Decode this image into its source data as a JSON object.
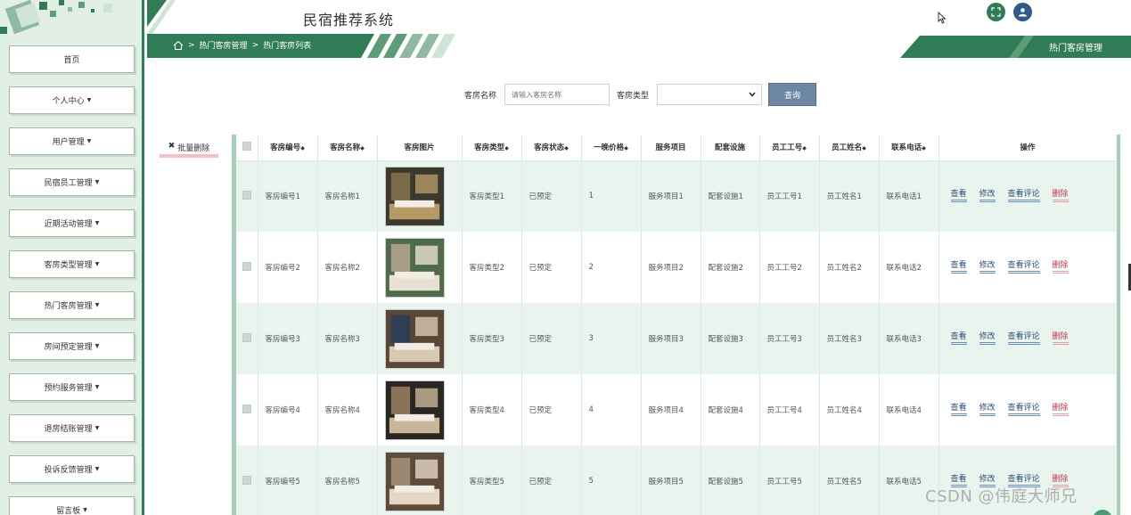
{
  "app": {
    "title": "民宿推荐系统"
  },
  "breadcrumb": {
    "items": [
      "热门客房管理",
      "热门客房列表"
    ]
  },
  "header": {
    "right_title": "热门客房管理"
  },
  "sidebar": {
    "items": [
      {
        "label": "首页",
        "dropdown": false
      },
      {
        "label": "个人中心",
        "dropdown": true
      },
      {
        "label": "用户管理",
        "dropdown": true
      },
      {
        "label": "民宿员工管理",
        "dropdown": true
      },
      {
        "label": "近期活动管理",
        "dropdown": true
      },
      {
        "label": "客房类型管理",
        "dropdown": true
      },
      {
        "label": "热门客房管理",
        "dropdown": true
      },
      {
        "label": "房间预定管理",
        "dropdown": true
      },
      {
        "label": "预约服务管理",
        "dropdown": true
      },
      {
        "label": "退房结账管理",
        "dropdown": true
      },
      {
        "label": "投诉反馈管理",
        "dropdown": true
      },
      {
        "label": "留言板",
        "dropdown": true
      }
    ]
  },
  "search": {
    "name_label": "客房名称",
    "name_placeholder": "请输入客房名称",
    "type_label": "客房类型",
    "type_value": "",
    "button": "查询"
  },
  "toolbar": {
    "batch_delete": "批量删除"
  },
  "table": {
    "columns": [
      "客房编号",
      "客房名称",
      "客房图片",
      "客房类型",
      "客房状态",
      "一晚价格",
      "服务项目",
      "配套设施",
      "员工工号",
      "员工姓名",
      "联系电话",
      "操作"
    ],
    "rows": [
      {
        "no": "客房编号1",
        "name": "客房名称1",
        "type": "客房类型1",
        "status": "已预定",
        "price": "1",
        "service": "服务项目1",
        "facility": "配套设施1",
        "staff_no": "员工工号1",
        "staff_name": "员工姓名1",
        "phone": "联系电话1"
      },
      {
        "no": "客房编号2",
        "name": "客房名称2",
        "type": "客房类型2",
        "status": "已预定",
        "price": "2",
        "service": "服务项目2",
        "facility": "配套设施2",
        "staff_no": "员工工号2",
        "staff_name": "员工姓名2",
        "phone": "联系电话2"
      },
      {
        "no": "客房编号3",
        "name": "客房名称3",
        "type": "客房类型3",
        "status": "已预定",
        "price": "3",
        "service": "服务项目3",
        "facility": "配套设施3",
        "staff_no": "员工工号3",
        "staff_name": "员工姓名3",
        "phone": "联系电话3"
      },
      {
        "no": "客房编号4",
        "name": "客房名称4",
        "type": "客房类型4",
        "status": "已预定",
        "price": "4",
        "service": "服务项目4",
        "facility": "配套设施4",
        "staff_no": "员工工号4",
        "staff_name": "员工姓名4",
        "phone": "联系电话4"
      },
      {
        "no": "客房编号5",
        "name": "客房名称5",
        "type": "客房类型5",
        "status": "已预定",
        "price": "5",
        "service": "服务项目5",
        "facility": "配套设施5",
        "staff_no": "员工工号5",
        "staff_name": "员工姓名5",
        "phone": "联系电话5"
      }
    ],
    "actions": {
      "view": "查看",
      "edit": "修改",
      "comments": "查看评论",
      "delete": "删除"
    }
  },
  "watermark": "CSDN @伟庭大师兄",
  "colors": {
    "brand_green": "#2f7c57",
    "query_button": "#6d86a3",
    "row_alt": "#eaf4ee",
    "delete_link": "#c1324a"
  }
}
